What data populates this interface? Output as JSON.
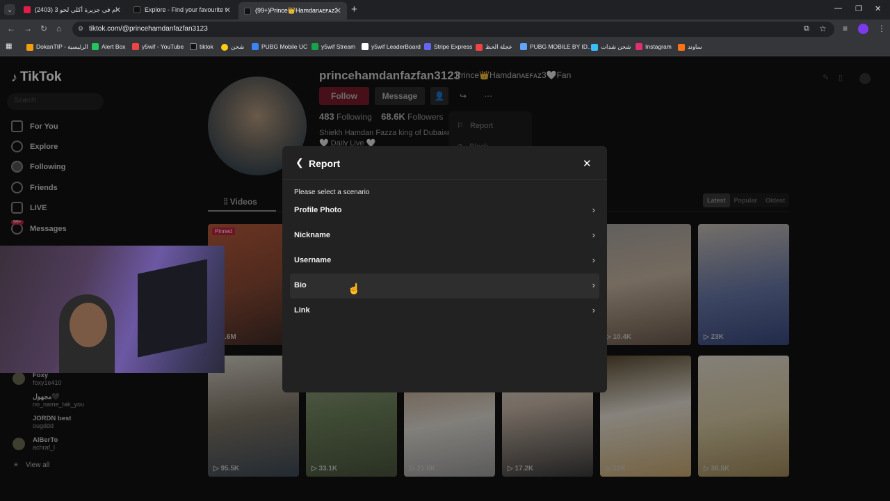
{
  "browser": {
    "tabs": [
      {
        "title": "(2403) 3 أيام في جزيرة أكلي لحو...",
        "fav_color": "#e11d48"
      },
      {
        "title": "Explore - Find your favourite vi...",
        "fav_color": "#111111"
      },
      {
        "title": "(99+)Prince👑Hamdanᴀᴇꜰᴀᴢ3💗",
        "fav_color": "#111111"
      }
    ],
    "url": "tiktok.com/@princehamdanfazfan3123",
    "bookmarks": [
      {
        "label": "DokanTIP - الرئيسية",
        "color": "#f59e0b"
      },
      {
        "label": "Alert Box",
        "color": "#22c55e"
      },
      {
        "label": "y5wif - YouTube",
        "color": "#ef4444"
      },
      {
        "label": "tiktok",
        "color": "#111111"
      },
      {
        "label": "شحن",
        "color": "#facc15"
      },
      {
        "label": "PUBG Mobile UC",
        "color": "#3b82f6"
      },
      {
        "label": "y5wif Stream",
        "color": "#16a34a"
      },
      {
        "label": "y5wif LeaderBoard",
        "color": "#ffffff"
      },
      {
        "label": "Stripe Express",
        "color": "#6366f1"
      },
      {
        "label": "عجلة الحظ",
        "color": "#ef4444"
      },
      {
        "label": "PUBG MOBILE BY ID...",
        "color": "#60a5fa"
      },
      {
        "label": "شحن شدات",
        "color": "#38bdf8"
      },
      {
        "label": "Instagram",
        "color": "#e1306c"
      },
      {
        "label": "ساوند",
        "color": "#f97316"
      }
    ]
  },
  "sidebar": {
    "logo": "TikTok",
    "search_placeholder": "Search",
    "items": [
      {
        "label": "For You"
      },
      {
        "label": "Explore"
      },
      {
        "label": "Following"
      },
      {
        "label": "Friends"
      },
      {
        "label": "LIVE"
      },
      {
        "label": "Messages",
        "badge": "99+"
      }
    ],
    "accounts": [
      {
        "name": "Foxy",
        "handle": "foxy1e410"
      },
      {
        "name": "مجهول🖤",
        "handle": "no_name_tak_you"
      },
      {
        "name": "JORDN best",
        "handle": "ougddd"
      },
      {
        "name": "AlBerTo",
        "handle": "achraf_l"
      }
    ],
    "view_all": "View all"
  },
  "profile": {
    "username": "princehamdanfazfan3123",
    "nickname": "Prince👑Hamdanᴀᴇꜰᴀᴢ3🤍Fan",
    "follow": "Follow",
    "message": "Message",
    "following_count": "483",
    "following_label": "Following",
    "followers_count": "68.6K",
    "followers_label": "Followers",
    "bio_line1": "Shiekh Hamdan Fazza king of Dubaiᴀᴇ",
    "bio_line2": "🤍 Daily Live 🤍",
    "dropdown_report": "Report",
    "dropdown_block": "Block"
  },
  "videos": {
    "tab_label": "Videos",
    "sort": [
      "Latest",
      "Popular",
      "Oldest"
    ],
    "pinned_label": "Pinned",
    "row1": [
      "2.6M",
      "",
      "",
      "",
      "10.4K",
      "23K"
    ],
    "row2": [
      "95.5K",
      "33.1K",
      "21.6K",
      "17.2K",
      "12K",
      "36.5K"
    ]
  },
  "modal": {
    "title": "Report",
    "prompt": "Please select a scenario",
    "options": [
      "Profile Photo",
      "Nickname",
      "Username",
      "Bio",
      "Link"
    ]
  }
}
